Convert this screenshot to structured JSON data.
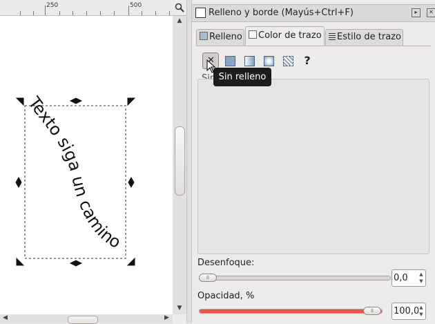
{
  "canvas": {
    "ruler": {
      "marks": [
        "250",
        "500"
      ]
    },
    "zoom_icon": "zoom-icon",
    "text_on_path": "Texto siga un camino"
  },
  "dialog": {
    "title": "Relleno y borde (Mayús+Ctrl+F)",
    "tabs": [
      {
        "label": "Relleno",
        "icon": "fill-tab-icon"
      },
      {
        "label": "Color de trazo",
        "icon": "stroke-paint-tab-icon",
        "active": true
      },
      {
        "label": "Estilo de trazo",
        "icon": "stroke-style-tab-icon"
      }
    ],
    "paint_buttons": [
      "no-paint",
      "flat-color",
      "linear-gradient",
      "radial-gradient",
      "pattern",
      "unset"
    ],
    "unset_label": "?",
    "tooltip": "Sin relleno",
    "sub_label": "Sin",
    "blur": {
      "label": "Desenfoque:",
      "value": "0,0",
      "fraction": 0
    },
    "opacity": {
      "label": "Opacidad, %",
      "value": "100,0",
      "fraction": 1
    }
  },
  "colors": {
    "accent_opacity": "#e8564a",
    "tooltip_bg": "#1d1d1b"
  }
}
